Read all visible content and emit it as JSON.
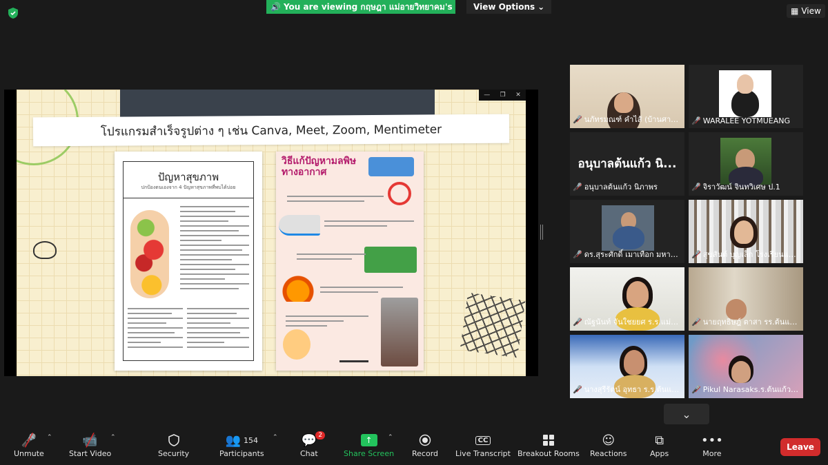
{
  "banner": {
    "viewing_text": "You are viewing กฤษฎา แม่อายวิทยาคม's screen",
    "view_options": "View Options",
    "view": "View"
  },
  "slide": {
    "title": "โปรแกรมสำเร็จรูปต่าง ๆ เช่น Canva, Meet, Zoom, Mentimeter",
    "left_poster_title": "ปัญหาสุขภาพ",
    "left_poster_sub": "ปกป้องตนเองจาก 4 ปัญหาสุขภาพที่พบได้บ่อย",
    "right_poster_title": "วิธีแก้ปัญหามลพิษทางอากาศ"
  },
  "participants": [
    {
      "name": "นภัทรมณฑ์ คำไส้ (บ้านศาลา)",
      "muted": true
    },
    {
      "name": "WARALEE YOTMUEANG",
      "muted": true
    },
    {
      "name": "อนุบาลต้นแก้ว นิภาพร",
      "muted": true,
      "big_label": "อนุบาลต้นแก้ว นิ..."
    },
    {
      "name": "จิราวัฒน์ จินทวิเศษ ป.1",
      "muted": true
    },
    {
      "name": "ดร.สุระศักดิ์ เมาเทือก มหาวิทย...",
      "muted": true,
      "active": true
    },
    {
      "name": "สุขสันต์ บุญเล็ก โรงเรียนแม่อ...",
      "muted": true
    },
    {
      "name": "ณัฐนันท์ จันใชยยศ ร.ร.แม่อาย...",
      "muted": true
    },
    {
      "name": "นายฤทธิษฎ์ ตาสา รร.ต้นแก้ว ...",
      "muted": true
    },
    {
      "name": "นางสุรีรัตน์ อุทธา ร.ร.ต้นแก้วผ...",
      "muted": true
    },
    {
      "name": "Pikul Narasaks.ร.ต้นแก้วผดุ...",
      "muted": true
    }
  ],
  "toolbar": {
    "unmute": "Unmute",
    "start_video": "Start Video",
    "security": "Security",
    "participants": "Participants",
    "participants_count": "154",
    "chat": "Chat",
    "chat_badge": "2",
    "share_screen": "Share Screen",
    "record": "Record",
    "live_transcript": "Live Transcript",
    "breakout_rooms": "Breakout Rooms",
    "reactions": "Reactions",
    "apps": "Apps",
    "more": "More",
    "leave": "Leave"
  },
  "colors": {
    "share_banner": "#23b05a",
    "active_speaker": "#c9e265",
    "leave": "#d12c2c"
  }
}
